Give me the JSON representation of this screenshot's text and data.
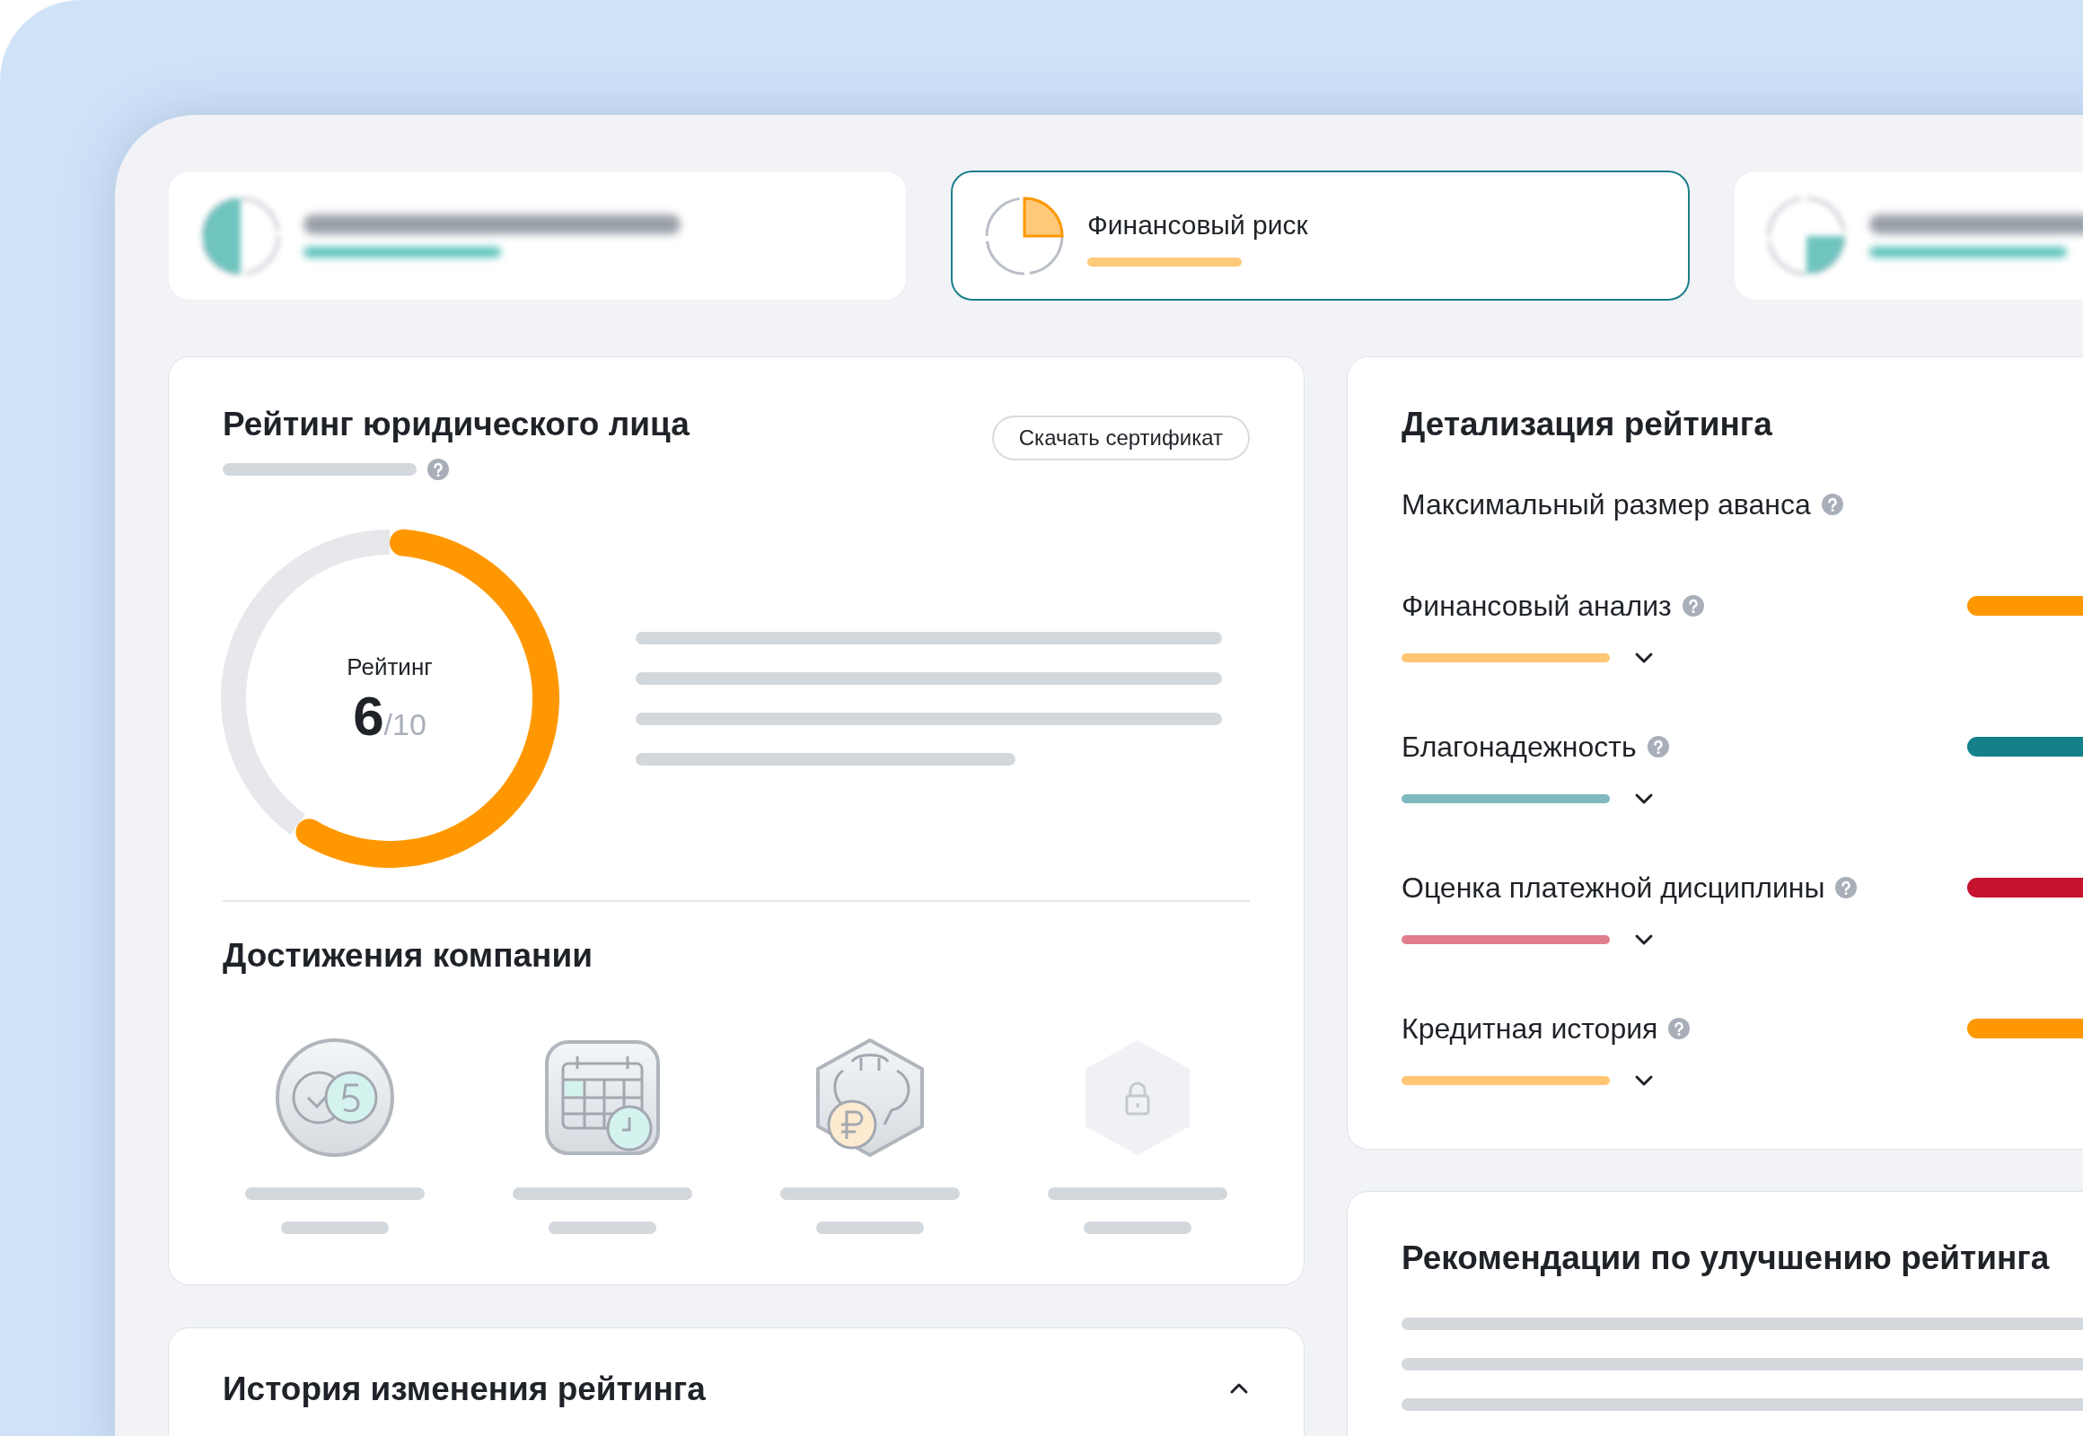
{
  "risk_cards": [
    {
      "color": "#6fc4bf",
      "selected": false,
      "kind": "half"
    },
    {
      "title": "Финансовый риск",
      "color": "#ffc97a",
      "selected": true,
      "kind": "quarter_top"
    },
    {
      "color": "#6fc4bf",
      "selected": false,
      "kind": "quarter_bottom"
    }
  ],
  "rating": {
    "title": "Рейтинг юридического лица",
    "button": "Скачать сертификат",
    "label": "Рейтинг",
    "score": "6",
    "max": "/10",
    "chart_data": {
      "type": "donut",
      "values": [
        60,
        40
      ]
    }
  },
  "achievements": {
    "title": "Достижения компании",
    "badges": [
      {
        "kind": "check_five"
      },
      {
        "kind": "calendar"
      },
      {
        "kind": "ruble"
      },
      {
        "kind": "locked"
      }
    ]
  },
  "history": {
    "title": "История изменения рейтинга",
    "expanded": true
  },
  "details": {
    "title": "Детализация рейтинга",
    "rows": [
      {
        "kind": "plain",
        "label": "Максимальный размер аванса"
      },
      {
        "kind": "metric",
        "label": "Финансовый анализ",
        "color": "#ff9800",
        "expanded": false
      },
      {
        "kind": "metric",
        "label": "Благонадежность",
        "color": "#14808a",
        "expanded": false
      },
      {
        "kind": "metric",
        "label": "Оценка платежной дисциплины",
        "color": "#c4122f",
        "expanded": false
      },
      {
        "kind": "metric",
        "label": "Кредитная история",
        "color": "#ff9800",
        "expanded": false
      }
    ]
  },
  "recommendations": {
    "title": "Рекомендации по улучшению рейтинга"
  }
}
